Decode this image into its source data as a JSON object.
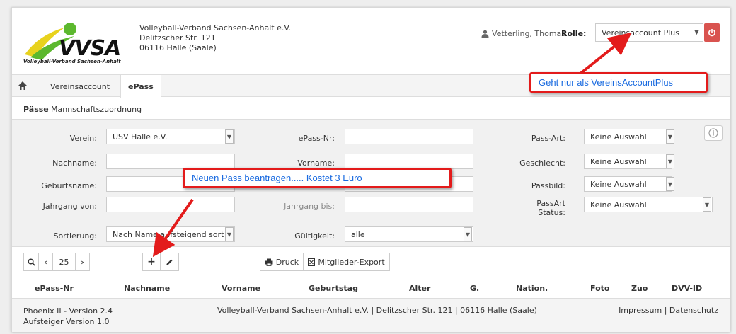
{
  "header": {
    "logo_text": "VVSA",
    "logo_subtitle": "Volleyball-Verband Sachsen-Anhalt",
    "org_lines": [
      "Volleyball-Verband Sachsen-Anhalt e.V.",
      "Delitzscher Str. 121",
      "06116 Halle (Saale)"
    ],
    "user_name": "Vetterling, Thomas",
    "role_label": "Rolle:",
    "role_value": "Vereinsaccount Plus"
  },
  "tabs": [
    {
      "label": "Vereinsaccount"
    },
    {
      "label": "ePass"
    }
  ],
  "subnav": {
    "items": [
      "Pässe",
      "Mannschaftszuordnung"
    ]
  },
  "filters": {
    "verein_label": "Verein:",
    "verein_value": "USV Halle e.V.",
    "nachname_label": "Nachname:",
    "geburtsname_label": "Geburtsname:",
    "jahrgang_von_label": "Jahrgang von:",
    "sortierung_label": "Sortierung:",
    "sortierung_value": "Nach Name aufsteigend sort",
    "epass_nr_label": "ePass-Nr:",
    "vorname_label": "Vorname:",
    "jahrgang_bis_label": "Jahrgang bis:",
    "gueltigkeit_label": "Gültigkeit:",
    "gueltigkeit_value": "alle",
    "pass_art_label": "Pass-Art:",
    "pass_art_value": "Keine Auswahl",
    "geschlecht_label": "Geschlecht:",
    "geschlecht_value": "Keine Auswahl",
    "passbild_label": "Passbild:",
    "passbild_value": "Keine Auswahl",
    "passart_status_label_1": "PassArt",
    "passart_status_label_2": "Status:",
    "passart_status_value": "Keine Auswahl"
  },
  "toolbar": {
    "page_size": "25",
    "druck_label": "Druck",
    "export_label": "Mitglieder-Export"
  },
  "table": {
    "columns": [
      "ePass-Nr",
      "Nachname",
      "Vorname",
      "Geburtstag",
      "Alter",
      "G.",
      "Nation.",
      "Foto",
      "Zuo",
      "DVV-ID"
    ]
  },
  "footer": {
    "version_line1": "Phoenix II - Version 2.4",
    "version_line2": "Aufsteiger Version 1.0",
    "address": "Volleyball-Verband Sachsen-Anhalt e.V. | Delitzscher Str. 121 | 06116 Halle (Saale)",
    "impressum": "Impressum",
    "separator": "|",
    "datenschutz": "Datenschutz"
  },
  "annotations": {
    "callout_role": "Geht nur als VereinsAccountPlus",
    "callout_new_pass": "Neuen Pass beantragen..... Kostet 3 Euro"
  },
  "colors": {
    "accent_red": "#d9534f",
    "callout_border": "#e31b1b",
    "callout_text": "#1a6be0",
    "logo_green": "#5cb82e",
    "logo_yellow": "#e8d21d"
  }
}
